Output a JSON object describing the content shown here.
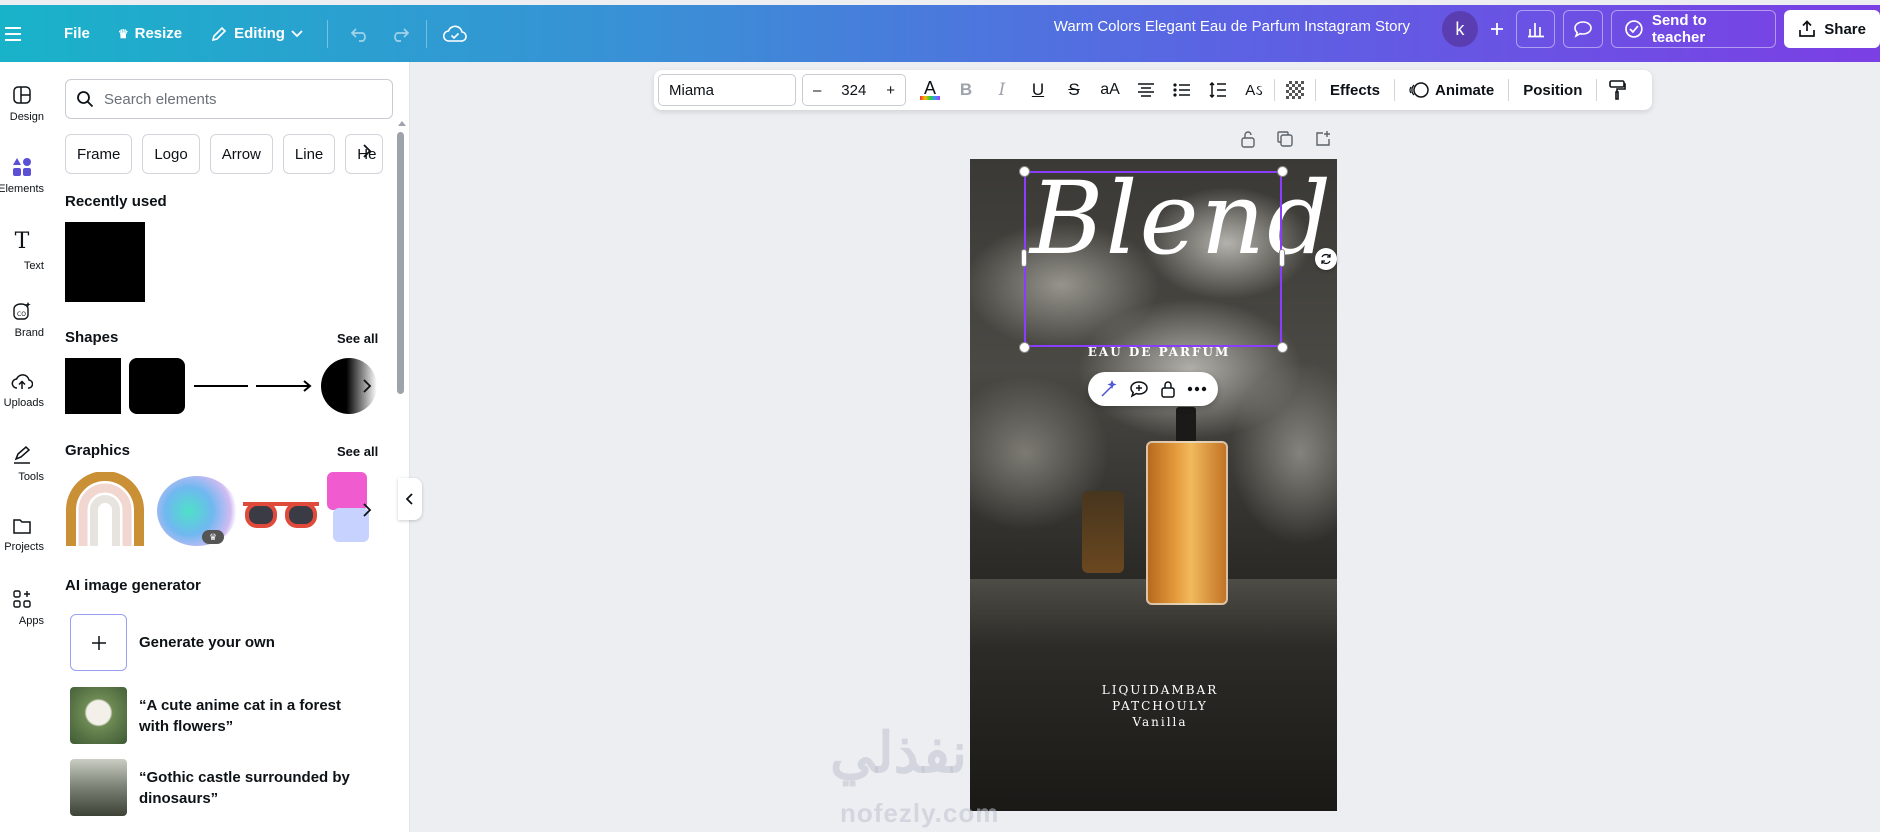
{
  "topbar": {
    "file": "File",
    "resize": "Resize",
    "editing": "Editing",
    "title": "Warm Colors Elegant Eau de Parfum Instagram Story",
    "avatar_letter": "k",
    "send": "Send to teacher",
    "share": "Share"
  },
  "rail": {
    "design": "Design",
    "elements": "Elements",
    "text": "Text",
    "brand": "Brand",
    "uploads": "Uploads",
    "tools": "Tools",
    "projects": "Projects",
    "apps": "Apps"
  },
  "panel": {
    "search_placeholder": "Search elements",
    "chips": [
      "Frame",
      "Logo",
      "Arrow",
      "Line",
      "He"
    ],
    "recently_used": "Recently used",
    "shapes": "Shapes",
    "graphics": "Graphics",
    "see_all": "See all",
    "ai_title": "AI image generator",
    "generate": "Generate your own",
    "prompt1": "“A cute anime cat in a forest with flowers”",
    "prompt2": "“Gothic castle surrounded by dinosaurs”"
  },
  "context": {
    "font": "Miama",
    "size": "324",
    "minus": "–",
    "plus": "+",
    "effects": "Effects",
    "animate": "Animate",
    "position": "Position"
  },
  "canvas": {
    "headline": "Blend",
    "subtitle": "EAU DE PARFUM",
    "note1": "LIQUIDAMBAR",
    "note2": "PATCHOULY",
    "note3": "Vanilla"
  },
  "watermark": {
    "arabic": "نفذلي",
    "latin": "nofezly.com"
  },
  "colors": {
    "accent": "#8b3dff",
    "gradient_start": "#19b3c9",
    "gradient_end": "#7b3fe4"
  }
}
